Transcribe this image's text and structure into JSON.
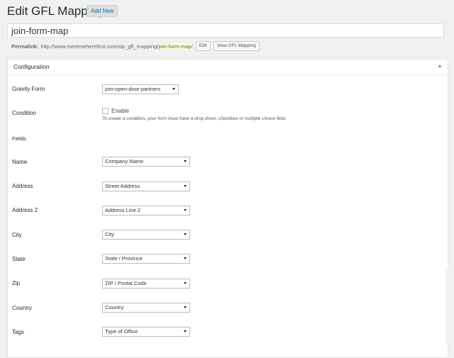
{
  "header": {
    "title": "Edit GFL Mapping",
    "add_new_label": "Add New"
  },
  "post_title": {
    "value": "join-form-map"
  },
  "permalink": {
    "label": "Permalink:",
    "base_url": "http://www.meetmeherefirst.com/slp_gfl_mapping/",
    "slug": "join-form-map",
    "trailing": "/",
    "edit_label": "Edit",
    "view_label": "View GFL Mapping"
  },
  "config": {
    "title": "Configuration",
    "gravity_form": {
      "label": "Gravity Form",
      "value": "join-open-door-partners"
    },
    "condition": {
      "label": "Condition",
      "enable_label": "Enable",
      "hint": "To create a condition, your form must have a drop down, checkbox or multiple choice field."
    },
    "fields_heading": "Fields",
    "fields": [
      {
        "label": "Name",
        "value": "Company Name"
      },
      {
        "label": "Address",
        "value": "Street Address"
      },
      {
        "label": "Address 2",
        "value": "Address Line 2"
      },
      {
        "label": "City",
        "value": "City"
      },
      {
        "label": "State",
        "value": "State / Province"
      },
      {
        "label": "Zip",
        "value": "ZIP / Postal Code"
      },
      {
        "label": "Country",
        "value": "Country"
      },
      {
        "label": "Tags",
        "value": "Type of Office"
      }
    ]
  }
}
